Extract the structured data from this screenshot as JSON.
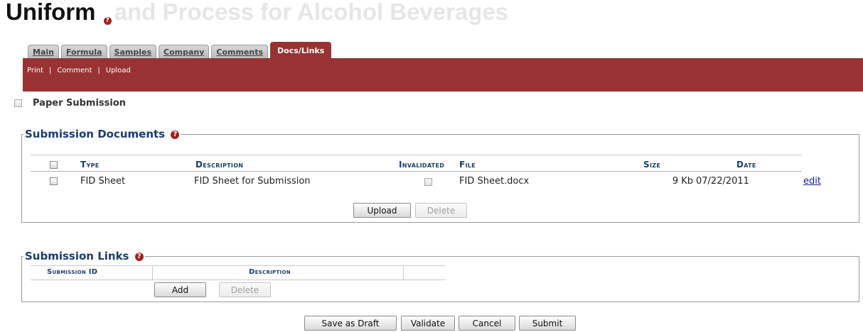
{
  "page": {
    "title": "Uniform",
    "title_faded": "and Process for Alcohol Beverages"
  },
  "tabs": [
    {
      "label": "Main",
      "active": false
    },
    {
      "label": "Formula",
      "active": false
    },
    {
      "label": "Samples",
      "active": false
    },
    {
      "label": "Company",
      "active": false
    },
    {
      "label": "Comments",
      "active": false
    },
    {
      "label": "Docs/Links",
      "active": true
    }
  ],
  "toolbar": {
    "print": "Print",
    "comment": "Comment",
    "upload": "Upload",
    "separator": "|",
    "color": "#993333"
  },
  "paper_submission": {
    "label": "Paper Submission",
    "checked": false
  },
  "documents": {
    "legend": "Submission Documents",
    "columns": {
      "type": "Type",
      "description": "Description",
      "invalidated": "Invalidated",
      "file": "File",
      "size": "Size",
      "date": "Date"
    },
    "rows": [
      {
        "type": "FID Sheet",
        "description": "FID Sheet for Submission",
        "invalidated": false,
        "file": "FID Sheet.docx",
        "size": "9 Kb",
        "date": "07/22/2011",
        "action": "edit"
      }
    ],
    "upload_label": "Upload",
    "delete_label": "Delete"
  },
  "links": {
    "legend": "Submission Links",
    "columns": {
      "submission_id": "Submission ID",
      "description": "Description"
    },
    "add_label": "Add",
    "delete_label": "Delete"
  },
  "footer": {
    "save_draft": "Save as Draft",
    "validate": "Validate",
    "cancel": "Cancel",
    "submit": "Submit"
  },
  "colors": {
    "accent": "#993333",
    "heading": "#1a3c6e",
    "help_icon": "#a32020"
  },
  "icons": {
    "help": "question-circle-icon"
  }
}
